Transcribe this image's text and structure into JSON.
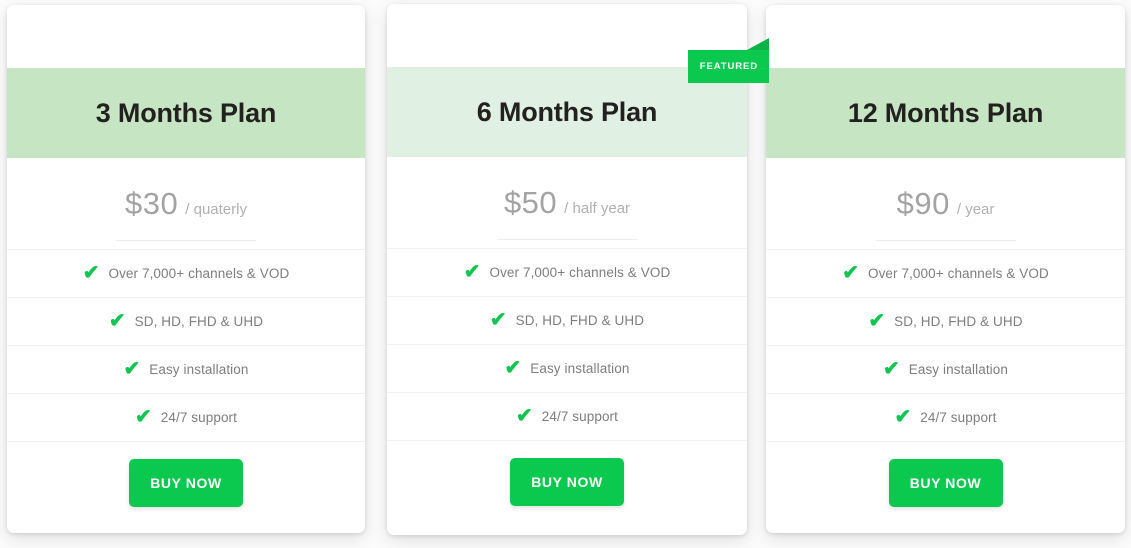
{
  "theme": {
    "accent_green": "#0ac94e",
    "check_green": "#12c551",
    "header_green": "#c6e6c3",
    "header_green_light": "#e0f0e2",
    "price_gray": "#a3a3a3",
    "feature_gray": "#7d7d7d",
    "page_background": "#fbfbfb"
  },
  "badge": {
    "label": "FEATURED"
  },
  "plans": [
    {
      "id": "plan-3-months",
      "title": "3 Months Plan",
      "price_amount": "$30",
      "price_period": "/ quaterly",
      "featured": false,
      "features": [
        "Over 7,000+ channels & VOD",
        "SD, HD, FHD & UHD",
        "Easy installation",
        "24/7 support"
      ],
      "cta_label": "BUY NOW",
      "check_icon": "check-icon"
    },
    {
      "id": "plan-6-months",
      "title": "6 Months Plan",
      "price_amount": "$50",
      "price_period": "/ half year",
      "featured": true,
      "features": [
        "Over 7,000+ channels & VOD",
        "SD, HD, FHD & UHD",
        "Easy installation",
        "24/7 support"
      ],
      "cta_label": "BUY NOW",
      "check_icon": "check-icon"
    },
    {
      "id": "plan-12-months",
      "title": "12 Months Plan",
      "price_amount": "$90",
      "price_period": "/ year",
      "featured": false,
      "features": [
        "Over 7,000+ channels & VOD",
        "SD, HD, FHD & UHD",
        "Easy installation",
        "24/7 support"
      ],
      "cta_label": "BUY NOW",
      "check_icon": "check-icon"
    }
  ],
  "icons": {
    "check": "✔"
  }
}
